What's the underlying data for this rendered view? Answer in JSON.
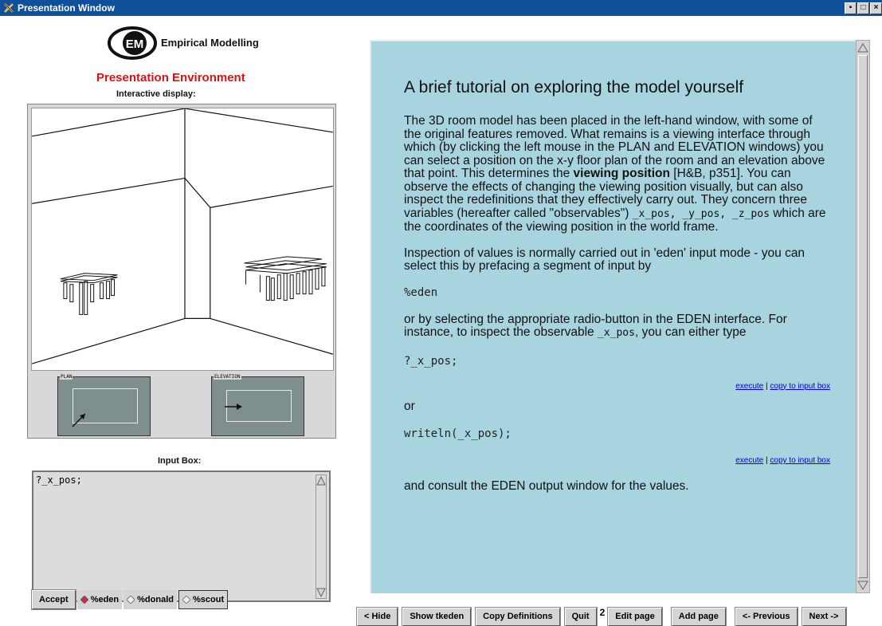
{
  "window": {
    "title": "Presentation Window",
    "controls": [
      "▪",
      "□",
      "×"
    ]
  },
  "logo": {
    "line1": "Empirical Modelling",
    "line2": "Presentation Environment"
  },
  "display": {
    "caption": "Interactive display:",
    "plan_label": "PLAN",
    "elevation_label": "ELEVATION"
  },
  "input": {
    "caption": "Input Box:",
    "value": "?_x_pos;"
  },
  "input_controls": {
    "accept": "Accept",
    "options": [
      "%eden",
      "%donald",
      "%scout"
    ],
    "selected": "%eden"
  },
  "panel": {
    "title": "A brief tutorial on exploring the model yourself",
    "p1_a": "The 3D room model has been placed in the left-hand window, with some of the original features removed. What remains is a viewing interface through which (by clicking the left mouse in the PLAN and ELEVATION windows) you can select a position on the x-y floor plan of the room and an elevation above that point. This determines the ",
    "p1_bold": "viewing position",
    "p1_b": " [H&B, p351]. You can observe the effects of changing the viewing position visually, but can also inspect the redefinitions that they effectively carry out. They concern three variables (hereafter called \"observables\") ",
    "p1_code": "_x_pos, _y_pos, _z_pos",
    "p1_c": " which are the coordinates of the viewing position in the world frame.",
    "p2": "Inspection of values is normally carried out in 'eden' input mode - you can select this by prefacing a segment of input by",
    "code1": "%eden",
    "p3_a": "or by selecting the appropriate radio-button in the EDEN interface. For instance, to inspect the observable ",
    "p3_code": "_x_pos",
    "p3_b": ", you can either type",
    "code2": "?_x_pos;",
    "link_execute": "execute",
    "link_separator": " | ",
    "link_copy": "copy to input box",
    "or": "or",
    "code3": "writeln(_x_pos);",
    "p4": "and consult the EDEN output window for the values."
  },
  "bottom_buttons": {
    "hide": "< Hide",
    "show_tkeden": "Show tkeden",
    "copy_definitions": "Copy Definitions",
    "quit": "Quit",
    "page_number": "2",
    "edit_page": "Edit page",
    "add_page": "Add page",
    "previous": "<- Previous",
    "next": "Next ->"
  }
}
